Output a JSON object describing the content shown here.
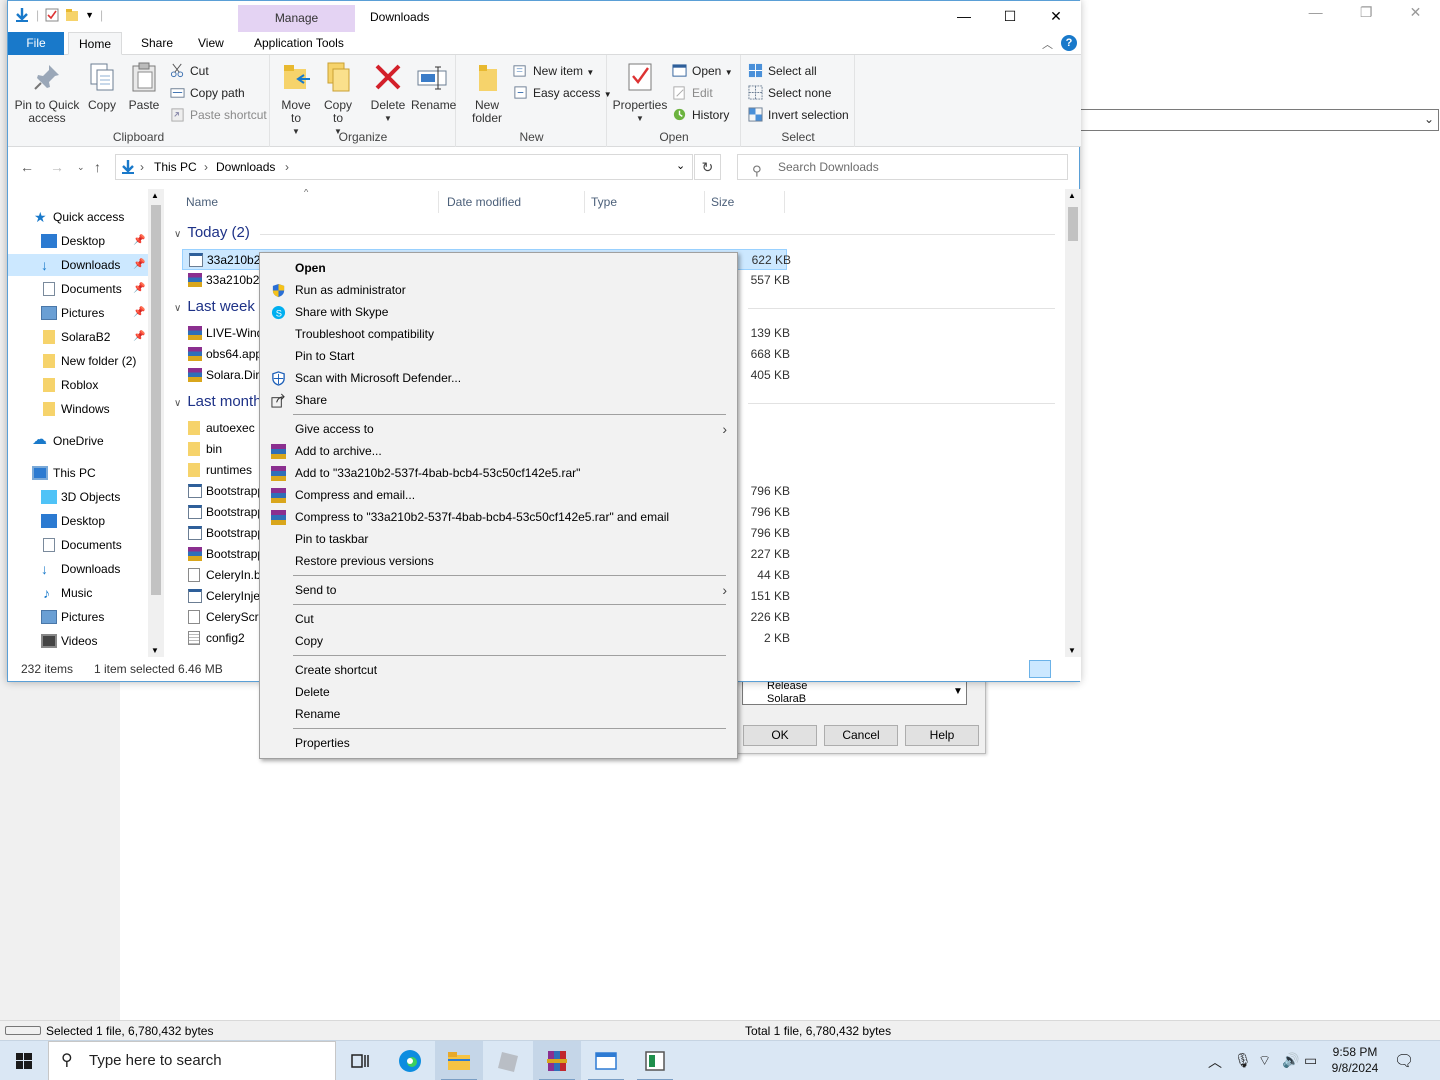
{
  "background_app": {
    "status_left": "Selected 1 file, 6,780,432 bytes",
    "status_right": "Total 1 file, 6,780,432 bytes",
    "dialog": {
      "list_items": [
        "Release",
        "SolaraB"
      ],
      "ok": "OK",
      "cancel": "Cancel",
      "help": "Help"
    }
  },
  "window": {
    "title": "Downloads",
    "context_tab": "Manage",
    "tabs": [
      "File",
      "Home",
      "Share",
      "View",
      "Application Tools"
    ],
    "help": "?",
    "controls": {
      "minimize": "—",
      "maximize": "☐",
      "close": "✕"
    }
  },
  "ribbon": {
    "clipboard": {
      "label": "Clipboard",
      "pin": "Pin to Quick access",
      "copy": "Copy",
      "paste": "Paste",
      "cut": "Cut",
      "copy_path": "Copy path",
      "paste_shortcut": "Paste shortcut"
    },
    "organize": {
      "label": "Organize",
      "move_to": "Move to",
      "copy_to": "Copy to",
      "delete": "Delete",
      "rename": "Rename"
    },
    "new": {
      "label": "New",
      "new_folder": "New folder",
      "new_item": "New item",
      "easy_access": "Easy access"
    },
    "open": {
      "label": "Open",
      "properties": "Properties",
      "open": "Open",
      "edit": "Edit",
      "history": "History"
    },
    "select": {
      "label": "Select",
      "select_all": "Select all",
      "select_none": "Select none",
      "invert": "Invert selection"
    }
  },
  "address": {
    "crumbs": [
      "This PC",
      "Downloads"
    ],
    "search_placeholder": "Search Downloads"
  },
  "navpane": {
    "quick_access": "Quick access",
    "quick_items": [
      "Desktop",
      "Downloads",
      "Documents",
      "Pictures",
      "SolaraB2",
      "New folder (2)",
      "Roblox",
      "Windows"
    ],
    "onedrive": "OneDrive",
    "this_pc": "This PC",
    "pc_items": [
      "3D Objects",
      "Desktop",
      "Documents",
      "Downloads",
      "Music",
      "Pictures",
      "Videos"
    ]
  },
  "columns": {
    "name": "Name",
    "date": "Date modified",
    "type": "Type",
    "size": "Size"
  },
  "groups": {
    "today": "Today (2)",
    "last_week": "Last week (",
    "last_month": "Last month"
  },
  "files": {
    "today": [
      {
        "name": "33a210b2-",
        "size": "622 KB"
      },
      {
        "name": "33a210b2-",
        "size": "557 KB"
      }
    ],
    "last_week": [
      {
        "name": "LIVE-Wind",
        "size": "139 KB"
      },
      {
        "name": "obs64.app",
        "size": "668 KB"
      },
      {
        "name": "Solara.Dir",
        "size": "405 KB"
      }
    ],
    "last_month": [
      {
        "name": "autoexec",
        "size": ""
      },
      {
        "name": "bin",
        "size": ""
      },
      {
        "name": "runtimes",
        "size": ""
      },
      {
        "name": "Bootstrapp",
        "size": "796 KB"
      },
      {
        "name": "Bootstrapp",
        "size": "796 KB"
      },
      {
        "name": "Bootstrapp",
        "size": "796 KB"
      },
      {
        "name": "Bootstrapp",
        "size": "227 KB"
      },
      {
        "name": "CeleryIn.b",
        "size": "44 KB"
      },
      {
        "name": "CeleryInje",
        "size": "151 KB"
      },
      {
        "name": "CeleryScri",
        "size": "226 KB"
      },
      {
        "name": "config2",
        "size": "2 KB"
      }
    ]
  },
  "status": {
    "items": "232 items",
    "selected": "1 item selected  6.46 MB"
  },
  "context_menu": {
    "open": "Open",
    "run_admin": "Run as administrator",
    "skype": "Share with Skype",
    "troubleshoot": "Troubleshoot compatibility",
    "pin_start": "Pin to Start",
    "defender": "Scan with Microsoft Defender...",
    "share": "Share",
    "give_access": "Give access to",
    "add_archive": "Add to archive...",
    "add_rar": "Add to \"33a210b2-537f-4bab-bcb4-53c50cf142e5.rar\"",
    "compress_email": "Compress and email...",
    "compress_rar_email": "Compress to \"33a210b2-537f-4bab-bcb4-53c50cf142e5.rar\" and email",
    "pin_taskbar": "Pin to taskbar",
    "restore": "Restore previous versions",
    "send_to": "Send to",
    "cut": "Cut",
    "copy": "Copy",
    "create_shortcut": "Create shortcut",
    "delete": "Delete",
    "rename": "Rename",
    "properties": "Properties"
  },
  "taskbar": {
    "search_placeholder": "Type here to search",
    "time": "9:58 PM",
    "date": "9/8/2024"
  },
  "colors": {
    "accent": "#1979ca",
    "selection": "#cce8ff",
    "manage_tab": "#e4d3f3",
    "taskbar": "#dae7f4"
  }
}
